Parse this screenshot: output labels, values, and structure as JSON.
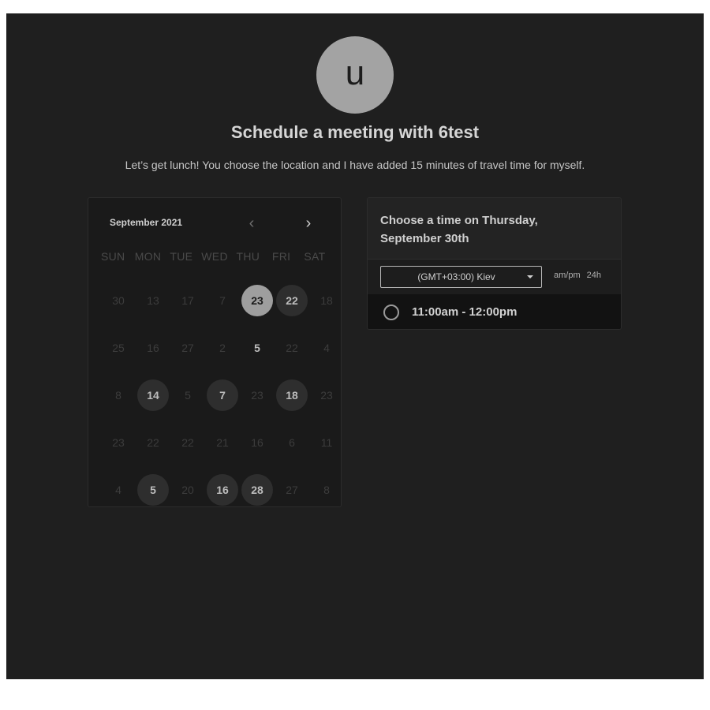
{
  "host": {
    "avatar_initial": "u",
    "title": "Schedule a meeting with 6test",
    "description": "Let’s get lunch! You choose the location and I have added 15 minutes of travel time for myself."
  },
  "calendar": {
    "month": "September 2021",
    "prev_icon": "chevron-left-icon",
    "next_icon": "chevron-right-icon",
    "prev_glyph": "‹",
    "next_glyph": "›",
    "weekdays": [
      "SUN",
      "MON",
      "TUE",
      "WED",
      "THU",
      "FRI",
      "SAT"
    ],
    "weeks": [
      [
        "30",
        "13",
        "17",
        "7",
        "23",
        "22",
        "18"
      ],
      [
        "25",
        "16",
        "27",
        "2",
        "5",
        "22",
        "4"
      ],
      [
        "8",
        "14",
        "5",
        "7",
        "23",
        "18",
        "23"
      ],
      [
        "23",
        "22",
        "22",
        "21",
        "16",
        "6",
        "11"
      ],
      [
        "4",
        "5",
        "20",
        "16",
        "28",
        "27",
        "8"
      ]
    ],
    "states": [
      [
        "",
        "",
        "",
        "",
        "selected",
        "available",
        ""
      ],
      [
        "",
        "",
        "",
        "",
        "plain-bold",
        "",
        ""
      ],
      [
        "",
        "available",
        "",
        "available",
        "",
        "available",
        ""
      ],
      [
        "",
        "",
        "",
        "",
        "",
        "",
        ""
      ],
      [
        "",
        "available",
        "",
        "available",
        "available",
        "",
        ""
      ]
    ]
  },
  "time_panel": {
    "heading": "Choose a time on Thursday, September 30th",
    "timezone": "(GMT+03:00) Kiev",
    "format_ampm": "am/pm",
    "format_24h": "24h",
    "slots": [
      "11:00am - 12:00pm"
    ]
  },
  "colors": {
    "background": "#1f1f1f",
    "card": "#1a1a1a",
    "selected_day": "#9e9e9e",
    "available_day": "#2e2e2e",
    "text": "#d6d6d6"
  }
}
